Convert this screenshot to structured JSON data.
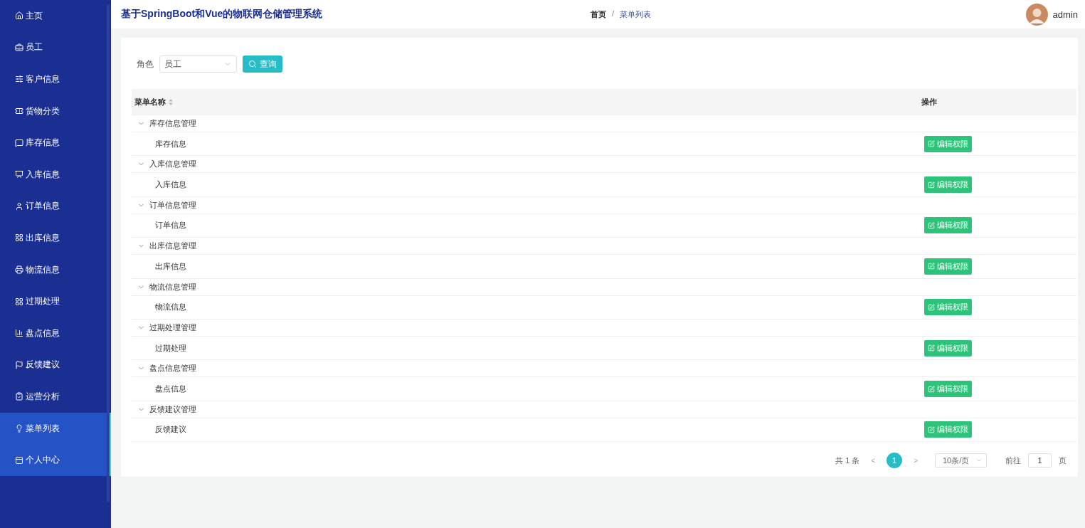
{
  "sidebar": {
    "items": [
      {
        "label": "主页",
        "selected": false,
        "hovered": false
      },
      {
        "label": "员工",
        "selected": false,
        "hovered": false
      },
      {
        "label": "客户信息",
        "selected": false,
        "hovered": false
      },
      {
        "label": "货物分类",
        "selected": false,
        "hovered": false
      },
      {
        "label": "库存信息",
        "selected": false,
        "hovered": false
      },
      {
        "label": "入库信息",
        "selected": false,
        "hovered": false
      },
      {
        "label": "订单信息",
        "selected": false,
        "hovered": false
      },
      {
        "label": "出库信息",
        "selected": false,
        "hovered": false
      },
      {
        "label": "物流信息",
        "selected": false,
        "hovered": false
      },
      {
        "label": "过期处理",
        "selected": false,
        "hovered": false
      },
      {
        "label": "盘点信息",
        "selected": false,
        "hovered": false
      },
      {
        "label": "反馈建议",
        "selected": false,
        "hovered": false
      },
      {
        "label": "运营分析",
        "selected": false,
        "hovered": false
      },
      {
        "label": "菜单列表",
        "selected": true,
        "hovered": false
      },
      {
        "label": "个人中心",
        "selected": true,
        "hovered": false
      }
    ]
  },
  "header": {
    "title": "基于SpringBoot和Vue的物联网仓储管理系统",
    "breadcrumb": [
      "首页",
      "菜单列表"
    ],
    "breadcrumb_separator": "/",
    "user": "admin"
  },
  "filter": {
    "label": "角色",
    "value": "员工",
    "button": "查询"
  },
  "table": {
    "columns": [
      "菜单名称",
      "操作"
    ],
    "rows": [
      {
        "name": "库存信息管理",
        "expanded": true,
        "children": [
          {
            "name": "库存信息",
            "action": "编辑权限"
          }
        ]
      },
      {
        "name": "入库信息管理",
        "expanded": true,
        "children": [
          {
            "name": "入库信息",
            "action": "编辑权限"
          }
        ]
      },
      {
        "name": "订单信息管理",
        "expanded": true,
        "children": [
          {
            "name": "订单信息",
            "action": "编辑权限"
          }
        ]
      },
      {
        "name": "出库信息管理",
        "expanded": true,
        "children": [
          {
            "name": "出库信息",
            "action": "编辑权限"
          }
        ]
      },
      {
        "name": "物流信息管理",
        "expanded": true,
        "children": [
          {
            "name": "物流信息",
            "action": "编辑权限"
          }
        ]
      },
      {
        "name": "过期处理管理",
        "expanded": true,
        "children": [
          {
            "name": "过期处理",
            "action": "编辑权限"
          }
        ]
      },
      {
        "name": "盘点信息管理",
        "expanded": true,
        "children": [
          {
            "name": "盘点信息",
            "action": "编辑权限"
          }
        ]
      },
      {
        "name": "反馈建议管理",
        "expanded": true,
        "children": [
          {
            "name": "反馈建议",
            "action": "编辑权限"
          }
        ]
      }
    ]
  },
  "pagination": {
    "total": "共 1 条",
    "prev": "<",
    "pages": [
      {
        "label": "1",
        "selected": true
      }
    ],
    "next": ">",
    "page_size": "10条/页",
    "goto_label": "前往",
    "goto_value": "1",
    "goto_suffix": "页"
  }
}
